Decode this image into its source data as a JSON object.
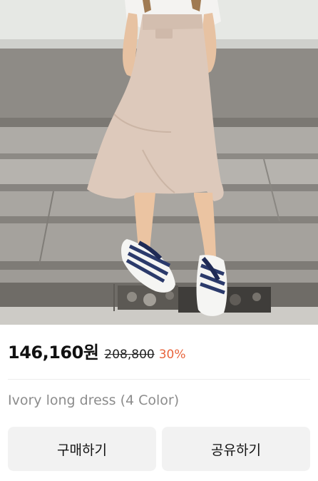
{
  "product": {
    "photo_icon": "product-photo",
    "price_current": "146,160원",
    "price_original": "208,800",
    "discount": "30%",
    "name": "Ivory long dress (4 Color)"
  },
  "actions": {
    "buy_label": "구매하기",
    "share_label": "공유하기"
  },
  "colors": {
    "discount": "#e8643c",
    "button_bg": "#f2f2f2",
    "name_text": "#8c8c8c"
  }
}
